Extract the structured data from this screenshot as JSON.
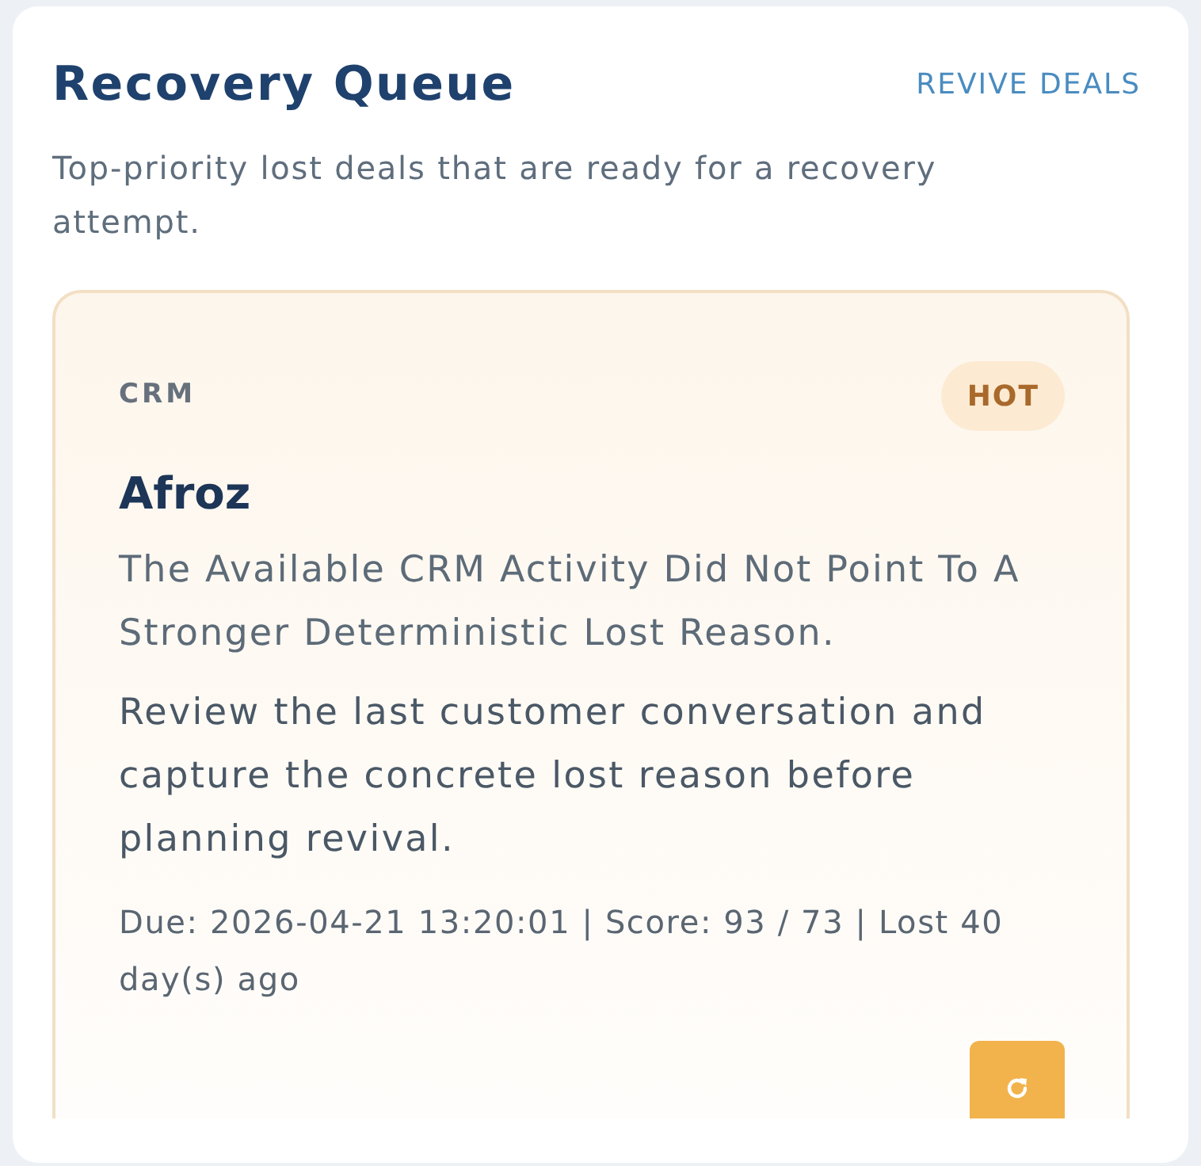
{
  "panel": {
    "title": "Recovery Queue",
    "action": "REVIVE DEALS",
    "description": "Top-priority lost deals that are ready for a recovery attempt."
  },
  "deals": [
    {
      "source": "CRM",
      "priority": {
        "label": "HOT",
        "kind": "hot"
      },
      "name": "Afroz",
      "reason": "The Available CRM Activity Did Not Point To A Stronger Deterministic Lost Reason.",
      "recommendation": "Review the last customer conversation and capture the concrete lost reason before planning revival.",
      "meta": "Due: 2026-04-21 13:20:01 | Score: 93 / 73 | Lost 40 day(s) ago"
    }
  ]
}
